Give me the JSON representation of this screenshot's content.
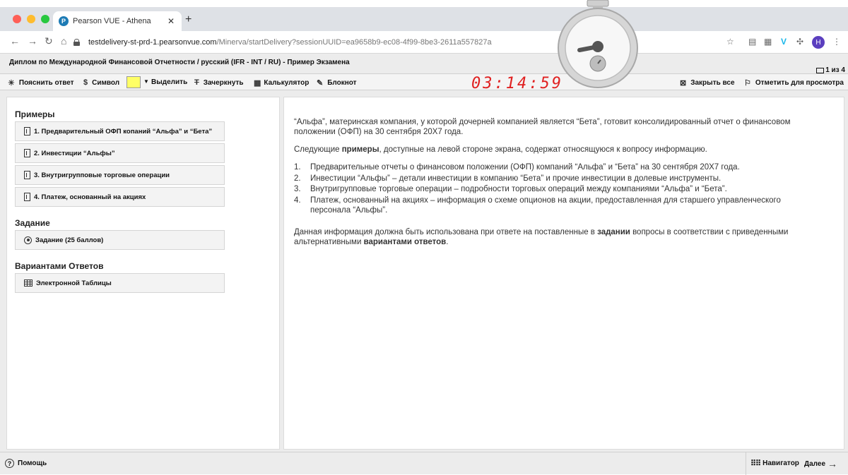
{
  "browser": {
    "tab_title": "Pearson VUE - Athena",
    "tab_favicon": "P",
    "url_host": "testdelivery-st-prd-1.pearsonvue.com",
    "url_path": "/Minerva/startDelivery?sessionUUID=ea9658b9-ec08-4f99-8be3-2611a557827a",
    "profile_initial": "H"
  },
  "exam": {
    "title": "Диплом по Международной Финансовой Отчетности / русский (IFR - INT / RU) - Пример Экзамена",
    "question_counter": "1 из 4",
    "timer": "03:14:59"
  },
  "tools": {
    "explain": "Пояснить ответ",
    "symbol": "Символ",
    "highlight": "Выделить",
    "strike": "Зачеркнуть",
    "calculator": "Калькулятор",
    "notepad": "Блокнот",
    "close_all": "Закрыть все",
    "flag": "Отметить для просмотра",
    "highlight_color": "#ffff66"
  },
  "sidebar": {
    "examples_header": "Примеры",
    "examples": [
      {
        "label": "1. Предварительный ОФП копаний “Альфа” и “Бета”"
      },
      {
        "label": "2. Инвестиции “Альфы”"
      },
      {
        "label": "3. Внутригрупповые торговые операции"
      },
      {
        "label": "4. Платеж, основанный на акциях"
      }
    ],
    "task_header": "Задание",
    "task_item": "Задание (25 баллов)",
    "answers_header": "Вариантами Ответов",
    "answers_item": "Электронной Таблицы"
  },
  "content": {
    "p1": "“Альфа”, материнская компания, у которой дочерней компанией является “Бета”, готовит консолидированный отчет о финансовом положении (ОФП) на 30 сентября 20X7 года.",
    "p2_a": "Следующие ",
    "p2_b": "примеры",
    "p2_c": ", доступные на левой стороне экрана, содержат относящуюся к вопросу информацию.",
    "list": [
      {
        "num": "1.",
        "text": "Предварительные отчеты о финансовом положении (ОФП) компаний “Альфа” и “Бета” на 30 сентября 20X7 года."
      },
      {
        "num": "2.",
        "text": "Инвестиции “Альфы” – детали инвестиции в компанию “Бета” и прочие инвестиции в долевые инструменты."
      },
      {
        "num": "3.",
        "text": "Внутригрупповые торговые операции – подробности торговых операций между компаниями “Альфа” и “Бета”."
      },
      {
        "num": "4.",
        "text": "Платеж, основанный на акциях – информация о схеме опционов на акции, предоставленная для старшего управленческого персонала “Альфы”."
      }
    ],
    "p3_a": "Данная информация должна быть использована при ответе на поставленные в ",
    "p3_b": "задании",
    "p3_c": " вопросы в соответствии с приведенными альтернативными ",
    "p3_d": "вариантами ответов",
    "p3_e": "."
  },
  "footer": {
    "help": "Помощь",
    "navigator": "Навигатор",
    "next": "Далее"
  }
}
